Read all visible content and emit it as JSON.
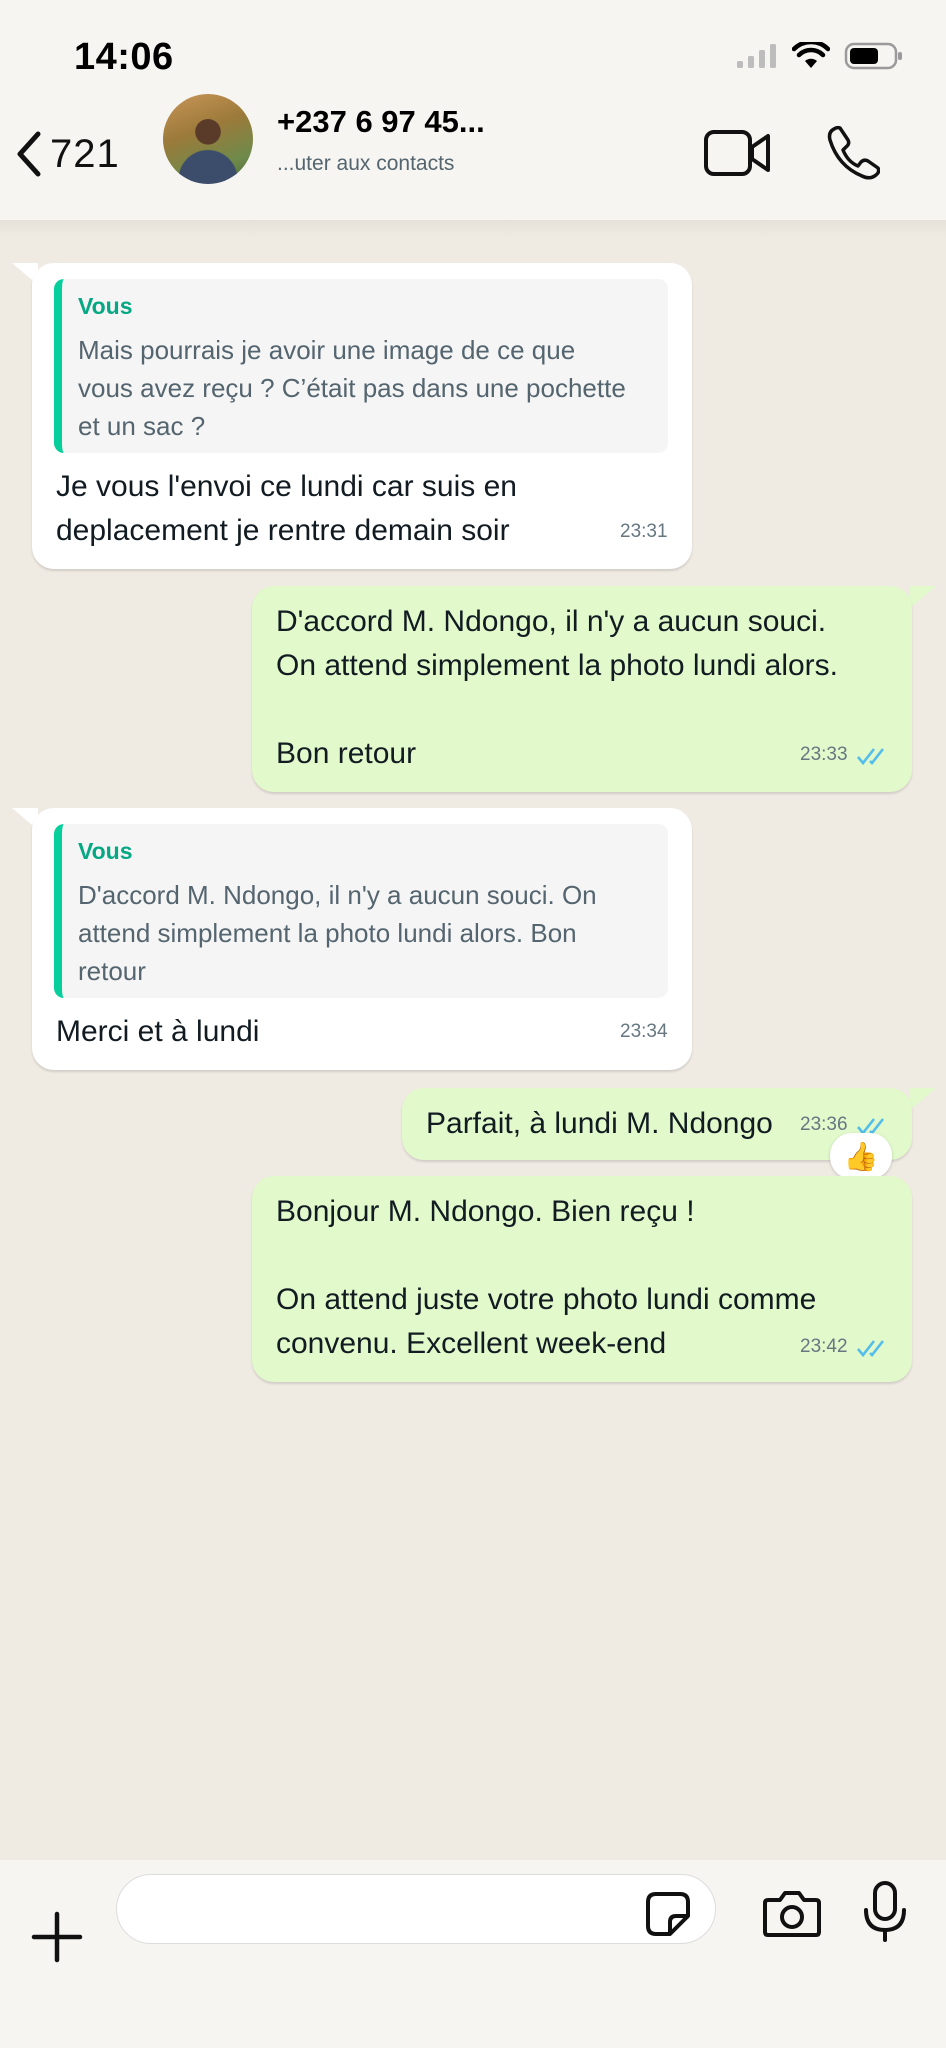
{
  "status_bar": {
    "time": "14:06"
  },
  "header": {
    "unread_count": "721",
    "contact_name": "+237 6 97 45...",
    "contact_subtitle": "...uter aux contacts",
    "icons": [
      "chevron-left-icon",
      "video-call-icon",
      "phone-icon"
    ]
  },
  "messages": [
    {
      "direction": "in",
      "quote_author": "Vous",
      "quote_text": "Mais pourrais je avoir une image de ce que\nvous avez reçu ? C’était pas dans une pochette\net un sac ?",
      "text": "Je vous l'envoi ce lundi car suis en\ndeplacement je rentre demain soir",
      "time": "23:31"
    },
    {
      "direction": "out",
      "text": "D'accord M. Ndongo, il n'y a aucun souci.\nOn attend simplement la photo lundi alors.\n\nBon retour",
      "time": "23:33",
      "status": "read"
    },
    {
      "direction": "in",
      "quote_author": "Vous",
      "quote_text": "D'accord M. Ndongo, il n'y a aucun souci. On\nattend simplement la photo lundi alors. Bon\nretour",
      "text": "Merci et à lundi",
      "time": "23:34"
    },
    {
      "direction": "out",
      "text": "Parfait, à lundi M. Ndongo",
      "time": "23:36",
      "status": "read",
      "reaction": "👍"
    },
    {
      "direction": "out",
      "text": "Bonjour M. Ndongo. Bien reçu !\n\nOn attend juste votre photo lundi comme\nconvenu. Excellent week-end",
      "time": "23:42",
      "status": "read"
    }
  ],
  "input": {
    "placeholder": ""
  },
  "colors": {
    "background": "#efeae2",
    "incoming_bubble": "#ffffff",
    "outgoing_bubble": "#e1f9cb",
    "quote_bar": "#06cf9c",
    "read_ticks": "#53bdeb"
  }
}
